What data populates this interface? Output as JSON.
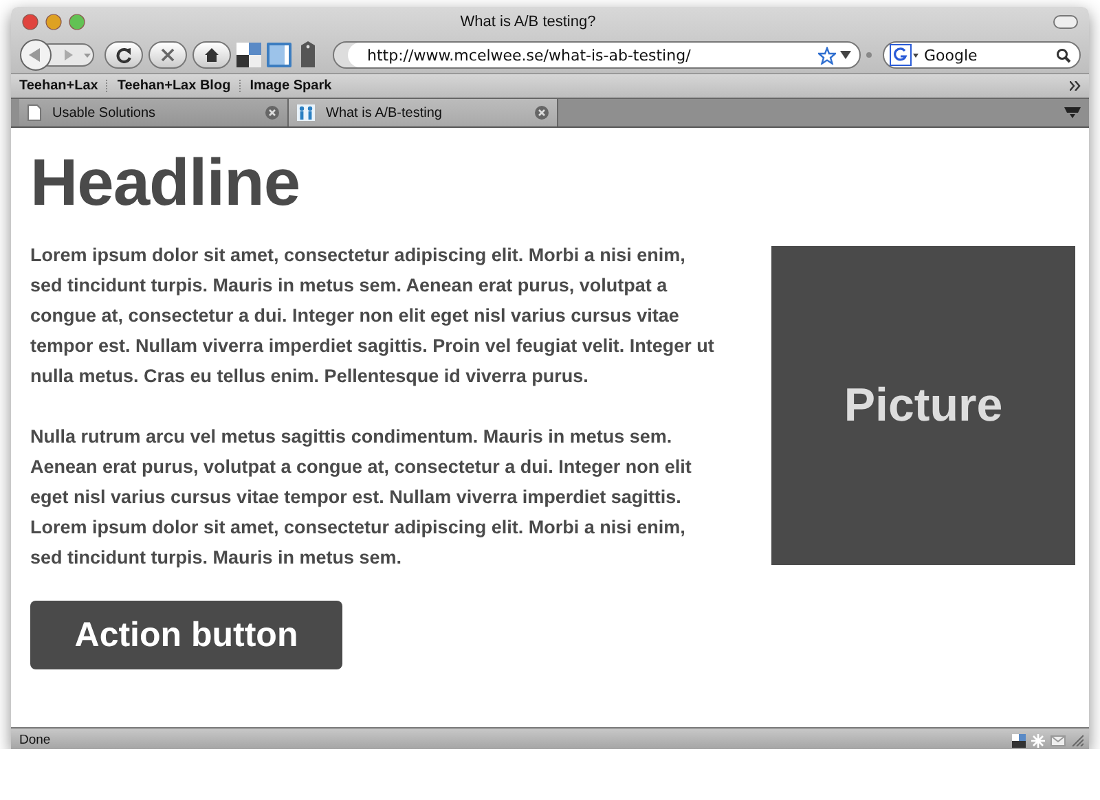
{
  "window": {
    "title": "What is A/B testing?"
  },
  "toolbar": {
    "url": "http://www.mcelwee.se/what-is-ab-testing/",
    "search": {
      "placeholder": "Google"
    }
  },
  "bookmarks": [
    "Teehan+Lax",
    "Teehan+Lax Blog",
    "Image Spark"
  ],
  "tabs": [
    {
      "label": "Usable Solutions",
      "selected": false
    },
    {
      "label": "What is A/B-testing",
      "selected": true
    }
  ],
  "page": {
    "headline": "Headline",
    "paragraphs": [
      "Lorem ipsum dolor sit amet, consectetur adipiscing elit. Morbi a nisi enim, sed tincidunt turpis. Mauris in metus sem. Aenean erat purus, volutpat a congue at, consectetur a dui. Integer non elit eget nisl varius cursus vitae tempor est. Nullam viverra imperdiet sagittis. Proin vel feugiat velit. Integer ut nulla metus. Cras eu tellus enim. Pellentesque id viverra purus.",
      "Nulla rutrum arcu vel metus sagittis condimentum. Mauris in metus sem. Aenean erat purus, volutpat a congue at, consectetur a dui. Integer non elit eget nisl varius cursus vitae tempor est. Nullam viverra imperdiet sagittis. Lorem ipsum dolor sit amet, consectetur adipiscing elit. Morbi a nisi enim, sed tincidunt turpis. Mauris in metus sem."
    ],
    "picture_label": "Picture",
    "button": "Action button"
  },
  "status_bar": {
    "text": "Done"
  }
}
